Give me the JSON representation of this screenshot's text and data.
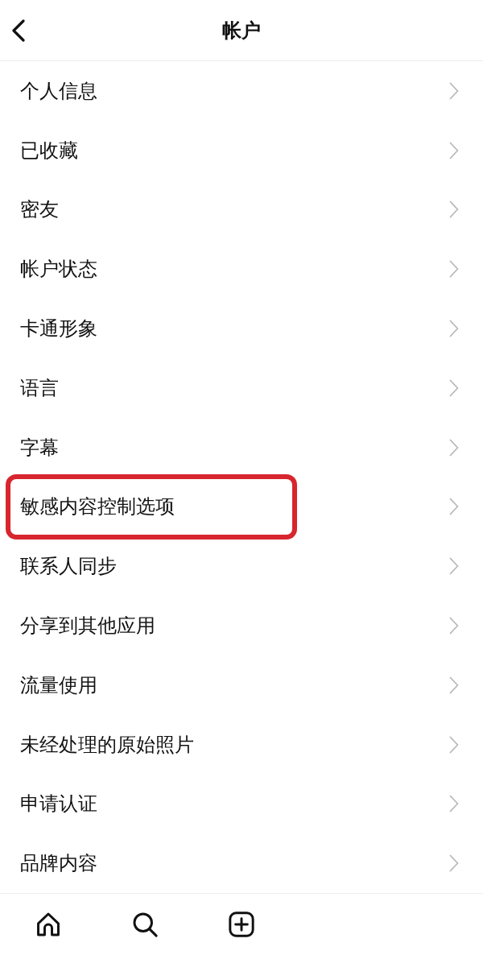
{
  "header": {
    "title": "帐户"
  },
  "menu": {
    "items": [
      {
        "label": "个人信息",
        "highlighted": false
      },
      {
        "label": "已收藏",
        "highlighted": false
      },
      {
        "label": "密友",
        "highlighted": false
      },
      {
        "label": "帐户状态",
        "highlighted": false
      },
      {
        "label": "卡通形象",
        "highlighted": false
      },
      {
        "label": "语言",
        "highlighted": false
      },
      {
        "label": "字幕",
        "highlighted": false
      },
      {
        "label": "敏感内容控制选项",
        "highlighted": true
      },
      {
        "label": "联系人同步",
        "highlighted": false
      },
      {
        "label": "分享到其他应用",
        "highlighted": false
      },
      {
        "label": "流量使用",
        "highlighted": false
      },
      {
        "label": "未经处理的原始照片",
        "highlighted": false
      },
      {
        "label": "申请认证",
        "highlighted": false
      },
      {
        "label": "品牌内容",
        "highlighted": false
      }
    ]
  },
  "bottom_nav": {
    "items": [
      {
        "kind": "home"
      },
      {
        "kind": "search"
      },
      {
        "kind": "add"
      }
    ]
  }
}
